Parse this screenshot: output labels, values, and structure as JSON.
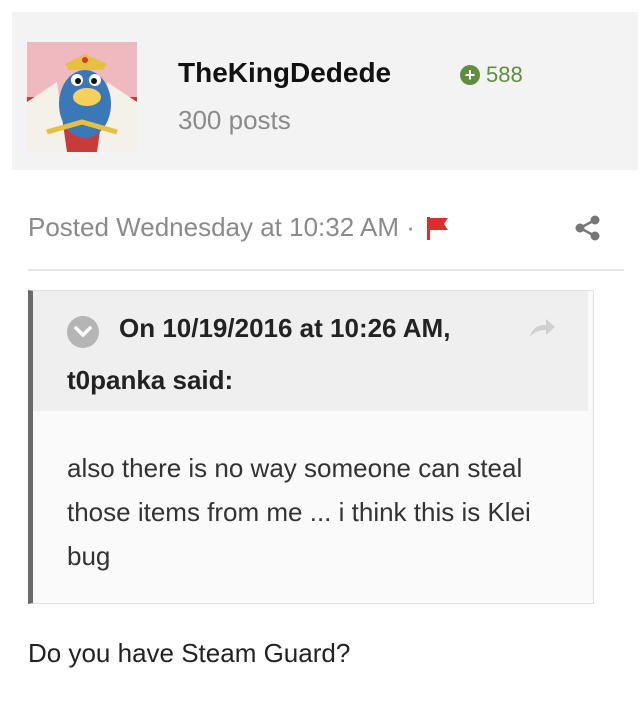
{
  "author": {
    "name": "TheKingDedede",
    "posts": "300 posts",
    "reputation": "588",
    "rep_color": "#5f8f3e"
  },
  "post": {
    "meta": "Posted Wednesday at 10:32 AM ·",
    "report_icon": "flag-icon",
    "share_icon": "share-icon"
  },
  "quote": {
    "header_line1": "On 10/19/2016 at 10:26 AM,",
    "header_line2": "t0panka said:",
    "body": "also there is no way someone can steal those items from me ... i think this is Klei bug"
  },
  "reply": "Do you have Steam Guard?"
}
